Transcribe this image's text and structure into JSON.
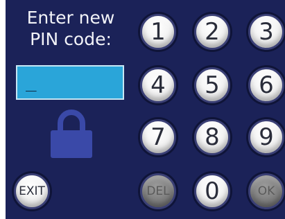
{
  "prompt": {
    "line1": "Enter new",
    "line2": "PIN code:"
  },
  "pin_display": {
    "value": "_"
  },
  "keypad": {
    "keys": [
      "1",
      "2",
      "3",
      "4",
      "5",
      "6",
      "7",
      "8",
      "9"
    ],
    "zero": "0",
    "delete": "DEL",
    "ok": "OK",
    "exit": "EXIT"
  },
  "icons": {
    "lock": "lock-icon"
  },
  "colors": {
    "background": "#1b2258",
    "display": "#2aa5d9",
    "lock": "#3a49a8",
    "key_enabled": "#f1f1f1",
    "key_disabled": "#7d7d7d"
  }
}
